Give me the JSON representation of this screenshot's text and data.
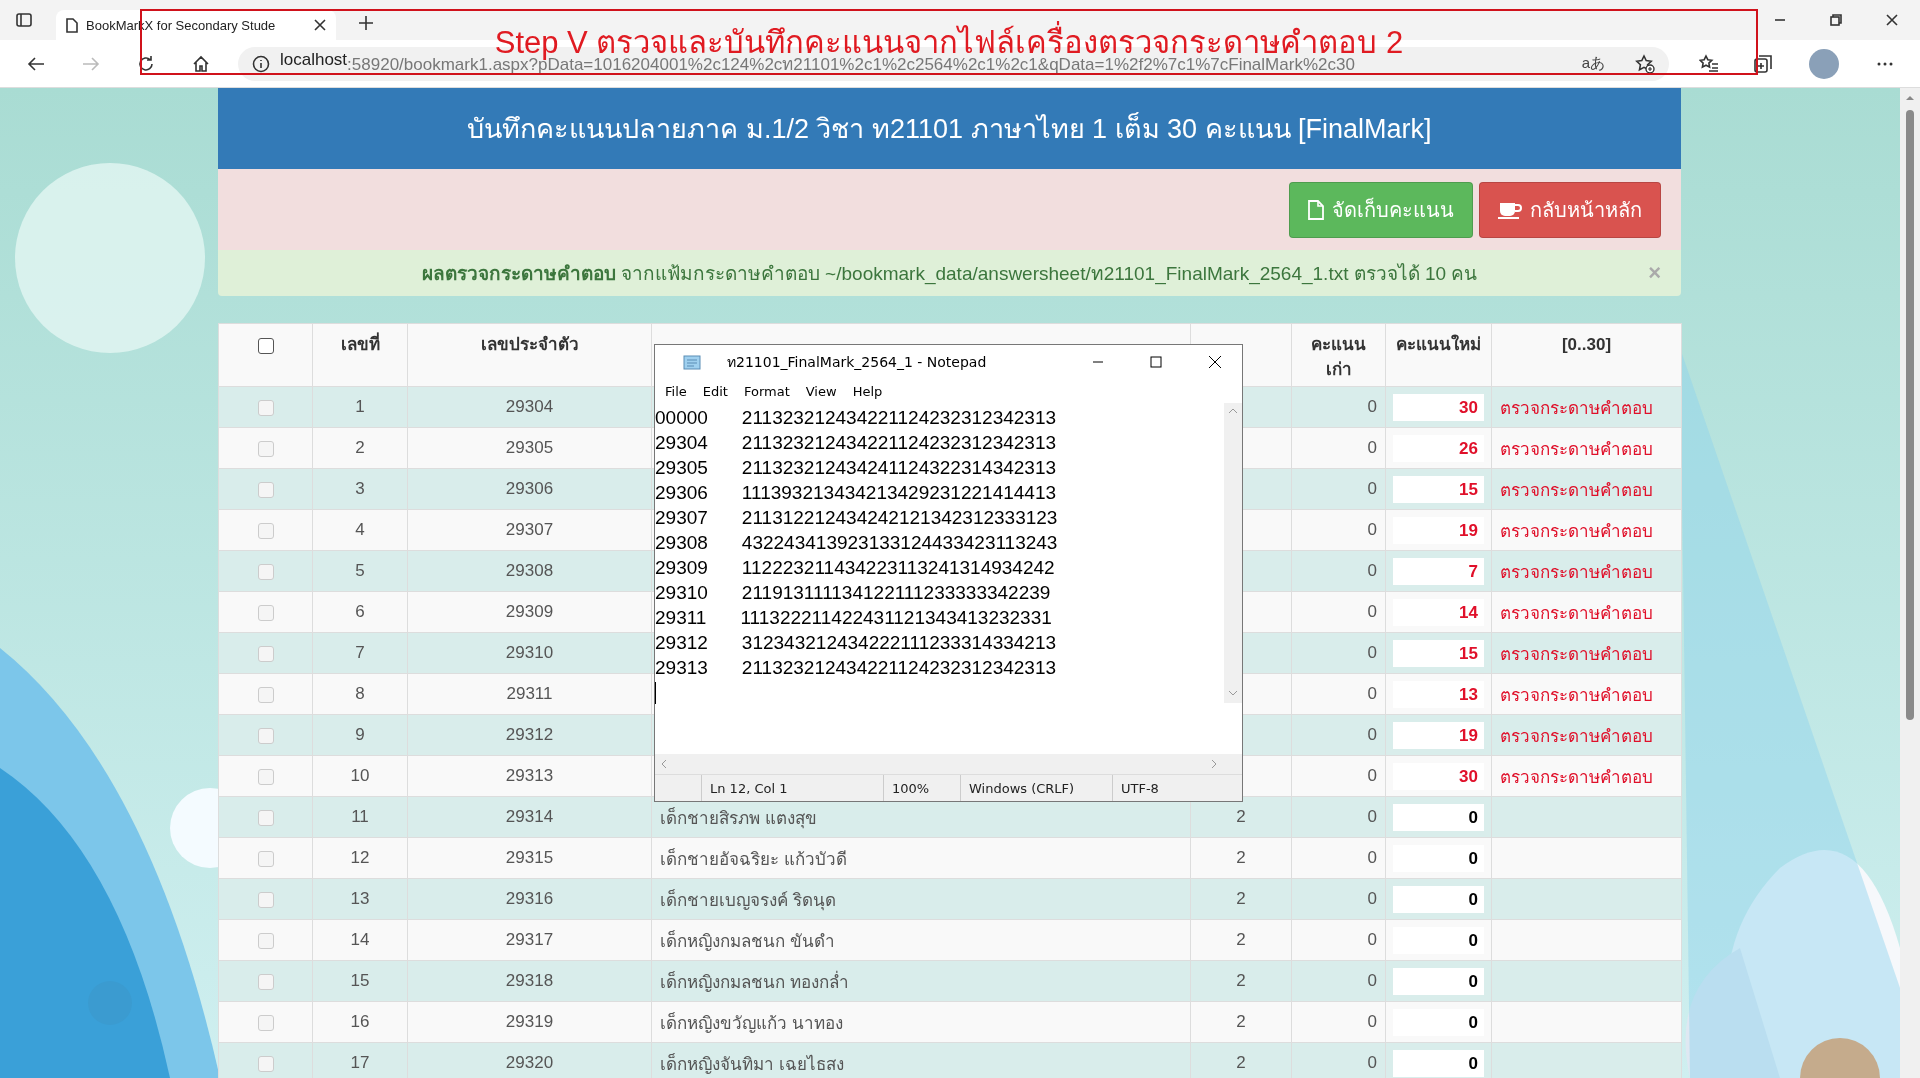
{
  "browser": {
    "tab_title": "BookMarkX for Secondary Stude",
    "url_host": "localhost",
    "url_path": ":58920/bookmark1.aspx?pData=1016204001%2c124%2cท21101%2c1%2c2564%2c1%2c1&qData=1%2f2%7c1%7cFinalMark%2c30",
    "reader_glyph": "aあ"
  },
  "annotation": "Step V ตรวจและบันทึกคะแนนจากไฟล์เครื่องตรวจกระดาษคำตอบ 2",
  "page": {
    "title": "บันทึกคะแนนปลายภาค ม.1/2 วิชา ท21101 ภาษาไทย 1 เต็ม 30 คะแนน [FinalMark]",
    "buttons": [
      {
        "label": "จัดเก็บคะแนน",
        "kind": "save"
      },
      {
        "label": "กลับหน้าหลัก",
        "kind": "home"
      }
    ],
    "alert": {
      "text": "**ผลตรวจกระดาษคำตอบ** จากแฟ้มกระดาษคำตอบ ~/bookmark_data/answersheet/ท21101_FinalMark_2564_1.txt ตรวจได้ 10 คน",
      "close": "×"
    }
  },
  "table": {
    "select_all_checked": false,
    "columns": [
      "เลขที่",
      "เลขประจำตัว",
      "คะแนนเก่า",
      "คะแนนใหม่",
      "[0..30]"
    ],
    "rows": [
      {
        "checked": false,
        "no": "1",
        "id": "29304",
        "old": "0",
        "new": "30",
        "graded": true,
        "link": "ตรวจกระดาษคำตอบ"
      },
      {
        "checked": false,
        "no": "2",
        "id": "29305",
        "old": "0",
        "new": "26",
        "graded": true,
        "link": "ตรวจกระดาษคำตอบ"
      },
      {
        "checked": false,
        "no": "3",
        "id": "29306",
        "old": "0",
        "new": "15",
        "graded": true,
        "link": "ตรวจกระดาษคำตอบ"
      },
      {
        "checked": false,
        "no": "4",
        "id": "29307",
        "old": "0",
        "new": "19",
        "graded": true,
        "link": "ตรวจกระดาษคำตอบ"
      },
      {
        "checked": false,
        "no": "5",
        "id": "29308",
        "old": "0",
        "new": "7",
        "graded": true,
        "link": "ตรวจกระดาษคำตอบ"
      },
      {
        "checked": false,
        "no": "6",
        "id": "29309",
        "old": "0",
        "new": "14",
        "graded": true,
        "link": "ตรวจกระดาษคำตอบ"
      },
      {
        "checked": false,
        "no": "7",
        "id": "29310",
        "old": "0",
        "new": "15",
        "graded": true,
        "link": "ตรวจกระดาษคำตอบ"
      },
      {
        "checked": false,
        "no": "8",
        "id": "29311",
        "old": "0",
        "new": "13",
        "graded": true,
        "link": "ตรวจกระดาษคำตอบ"
      },
      {
        "checked": false,
        "no": "9",
        "id": "29312",
        "old": "0",
        "new": "19",
        "graded": true,
        "link": "ตรวจกระดาษคำตอบ"
      },
      {
        "checked": false,
        "no": "10",
        "id": "29313",
        "old": "0",
        "new": "30",
        "graded": true,
        "link": "ตรวจกระดาษคำตอบ"
      },
      {
        "checked": false,
        "no": "11",
        "id": "29314",
        "name": "เด็กชายสิรภพ แตงสุข",
        "room": "2",
        "old": "0",
        "new": "0",
        "graded": false
      },
      {
        "checked": false,
        "no": "12",
        "id": "29315",
        "name": "เด็กชายอัจฉริยะ แก้วบัวดี",
        "room": "2",
        "old": "0",
        "new": "0",
        "graded": false
      },
      {
        "checked": false,
        "no": "13",
        "id": "29316",
        "name": "เด็กชายเบญจรงค์ ริดนุด",
        "room": "2",
        "old": "0",
        "new": "0",
        "graded": false
      },
      {
        "checked": false,
        "no": "14",
        "id": "29317",
        "name": "เด็กหญิงกมลชนก ขันดำ",
        "room": "2",
        "old": "0",
        "new": "0",
        "graded": false
      },
      {
        "checked": false,
        "no": "15",
        "id": "29318",
        "name": "เด็กหญิงกมลชนก ทองกล่ำ",
        "room": "2",
        "old": "0",
        "new": "0",
        "graded": false
      },
      {
        "checked": false,
        "no": "16",
        "id": "29319",
        "name": "เด็กหญิงขวัญแก้ว นาทอง",
        "room": "2",
        "old": "0",
        "new": "0",
        "graded": false
      },
      {
        "checked": false,
        "no": "17",
        "id": "29320",
        "name": "เด็กหญิงจันทิมา เฉยไธสง",
        "room": "2",
        "old": "0",
        "new": "0",
        "graded": false
      }
    ]
  },
  "notepad": {
    "title": "ท21101_FinalMark_2564_1 - Notepad",
    "menu": [
      "File",
      "Edit",
      "Format",
      "View",
      "Help"
    ],
    "lines": [
      {
        "id": "00000",
        "answers": "211323212434221124232312342313"
      },
      {
        "id": "29304",
        "answers": "211323212434221124232312342313"
      },
      {
        "id": "29305",
        "answers": "211323212434241124322314342313"
      },
      {
        "id": "29306",
        "answers": "111393213434213429231221414413"
      },
      {
        "id": "29307",
        "answers": "211312212434242121342312333123"
      },
      {
        "id": "29308",
        "answers": "432243413923133124433423113243"
      },
      {
        "id": "29309",
        "answers": "112223211434223113241314934242"
      },
      {
        "id": "29310",
        "answers": "211913111134122111233333342239"
      },
      {
        "id": "29311",
        "answers": "111322211422431121343413232331"
      },
      {
        "id": "29312",
        "answers": "312343212434222111233314334213"
      },
      {
        "id": "29313",
        "answers": "211323212434221124232312342313"
      }
    ],
    "status": [
      "Ln 12, Col 1",
      "100%",
      "Windows (CRLF)",
      "UTF-8"
    ]
  }
}
